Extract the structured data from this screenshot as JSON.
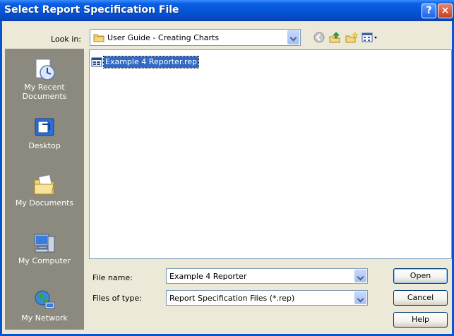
{
  "window": {
    "title": "Select Report Specification File",
    "help_glyph": "?",
    "close_glyph": "×"
  },
  "lookin": {
    "label": "Look in:",
    "value": "User Guide - Creating Charts"
  },
  "toolbar_icons": [
    "back-icon",
    "up-folder-icon",
    "new-folder-icon",
    "views-menu-icon"
  ],
  "places": [
    {
      "name": "my-recent-documents",
      "label_lines": [
        "My Recent",
        "Documents"
      ]
    },
    {
      "name": "desktop",
      "label_lines": [
        "Desktop"
      ]
    },
    {
      "name": "my-documents",
      "label_lines": [
        "My Documents"
      ]
    },
    {
      "name": "my-computer",
      "label_lines": [
        "My Computer"
      ]
    },
    {
      "name": "my-network",
      "label_lines": [
        "My Network"
      ]
    }
  ],
  "files": [
    {
      "name": "Example 4 Reporter.rep",
      "selected": true
    }
  ],
  "filename": {
    "label": "File name:",
    "value": "Example 4 Reporter"
  },
  "filetype": {
    "label": "Files of type:",
    "value": "Report Specification Files (*.rep)"
  },
  "buttons": {
    "open": "Open",
    "cancel": "Cancel",
    "help": "Help"
  },
  "colors": {
    "titlebar": "#0654d6",
    "selection": "#316ac5",
    "places_bar": "#8c8a7e",
    "dialog_bg": "#ece9d8"
  }
}
